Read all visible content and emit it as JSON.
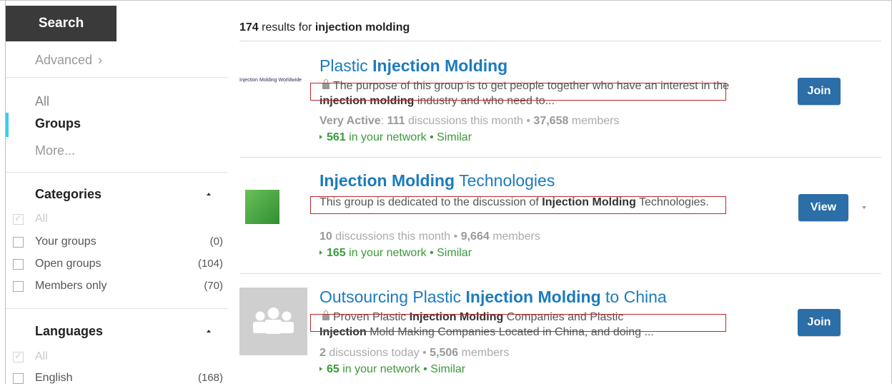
{
  "sidebar": {
    "search_button": "Search",
    "advanced": "Advanced",
    "nav": {
      "all": "All",
      "groups": "Groups",
      "more": "More..."
    },
    "categories": {
      "title": "Categories",
      "items": [
        {
          "label": "All",
          "count": "",
          "checked": true
        },
        {
          "label": "Your groups",
          "count": "(0)",
          "checked": false
        },
        {
          "label": "Open groups",
          "count": "(104)",
          "checked": false
        },
        {
          "label": "Members only",
          "count": "(70)",
          "checked": false
        }
      ]
    },
    "languages": {
      "title": "Languages",
      "items": [
        {
          "label": "All",
          "count": "",
          "checked": true
        },
        {
          "label": "English",
          "count": "(168)",
          "checked": false
        }
      ]
    }
  },
  "results": {
    "count": "174",
    "text": "results for",
    "query": "injection molding"
  },
  "groups": [
    {
      "title_pre": "Plastic ",
      "title_bold": "Injection Molding",
      "title_post": "",
      "logo_text": "Injection Molding Worldwide",
      "desc_a": "The purpose of this group is to get people together who have an interest in the ",
      "desc_b": "injection molding",
      "desc_c": " industry and who need to...",
      "meta_bold1": "Very Active",
      "meta_mid": ": ",
      "meta_bold2": "111",
      "meta_text": " discussions this month • ",
      "meta_bold3": "37,658",
      "meta_end": " members",
      "network_bold": "561",
      "network_text": " in your network • Similar",
      "button": "Join"
    },
    {
      "title_pre": "",
      "title_bold": "Injection Molding",
      "title_post": " Technologies",
      "desc_a": "This group is dedicated to the discussion of ",
      "desc_b": "Injection Molding",
      "desc_c": " Technologies.",
      "meta_bold2": "10",
      "meta_text": " discussions this month • ",
      "meta_bold3": "9,664",
      "meta_end": " members",
      "network_bold": "165",
      "network_text": " in your network • Similar",
      "button": "View"
    },
    {
      "title_pre": "Outsourcing Plastic ",
      "title_bold": "Injection Molding",
      "title_post": " to China",
      "desc_a": "Proven Plastic ",
      "desc_b": "Injection Molding",
      "desc_c": " Companies and Plastic ",
      "desc_d": "Injection",
      "desc_e": " Mold Making Companies Located in China, and doing ...",
      "meta_bold2": "2",
      "meta_text": " discussions today • ",
      "meta_bold3": "5,506",
      "meta_end": " members",
      "network_bold": "65",
      "network_text": " in your network • Similar",
      "button": "Join"
    }
  ]
}
